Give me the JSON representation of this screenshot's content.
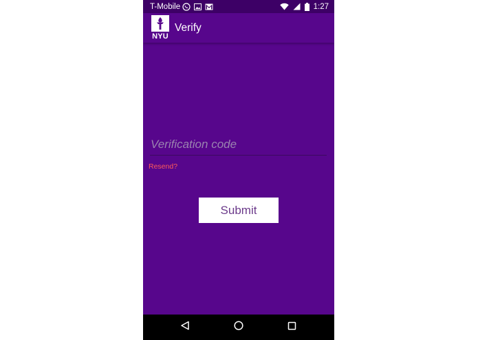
{
  "status_bar": {
    "carrier": "T-Mobile",
    "time": "1:27",
    "icons_left": [
      "whatsapp-icon",
      "image-icon",
      "gmail-icon"
    ],
    "icons_right": [
      "wifi-icon",
      "cellular-signal-icon",
      "battery-icon"
    ]
  },
  "app_bar": {
    "logo_text": "NYU",
    "title": "Verify"
  },
  "form": {
    "code_placeholder": "Verification code",
    "code_value": "",
    "resend_label": "Resend?",
    "submit_label": "Submit"
  },
  "nav_bar": {
    "buttons": [
      "back-icon",
      "home-icon",
      "recents-icon"
    ]
  },
  "colors": {
    "primary": "#57068c",
    "status_bar": "#3d0066",
    "resend": "#ff5a5a",
    "button_text": "#6b3a8a"
  }
}
